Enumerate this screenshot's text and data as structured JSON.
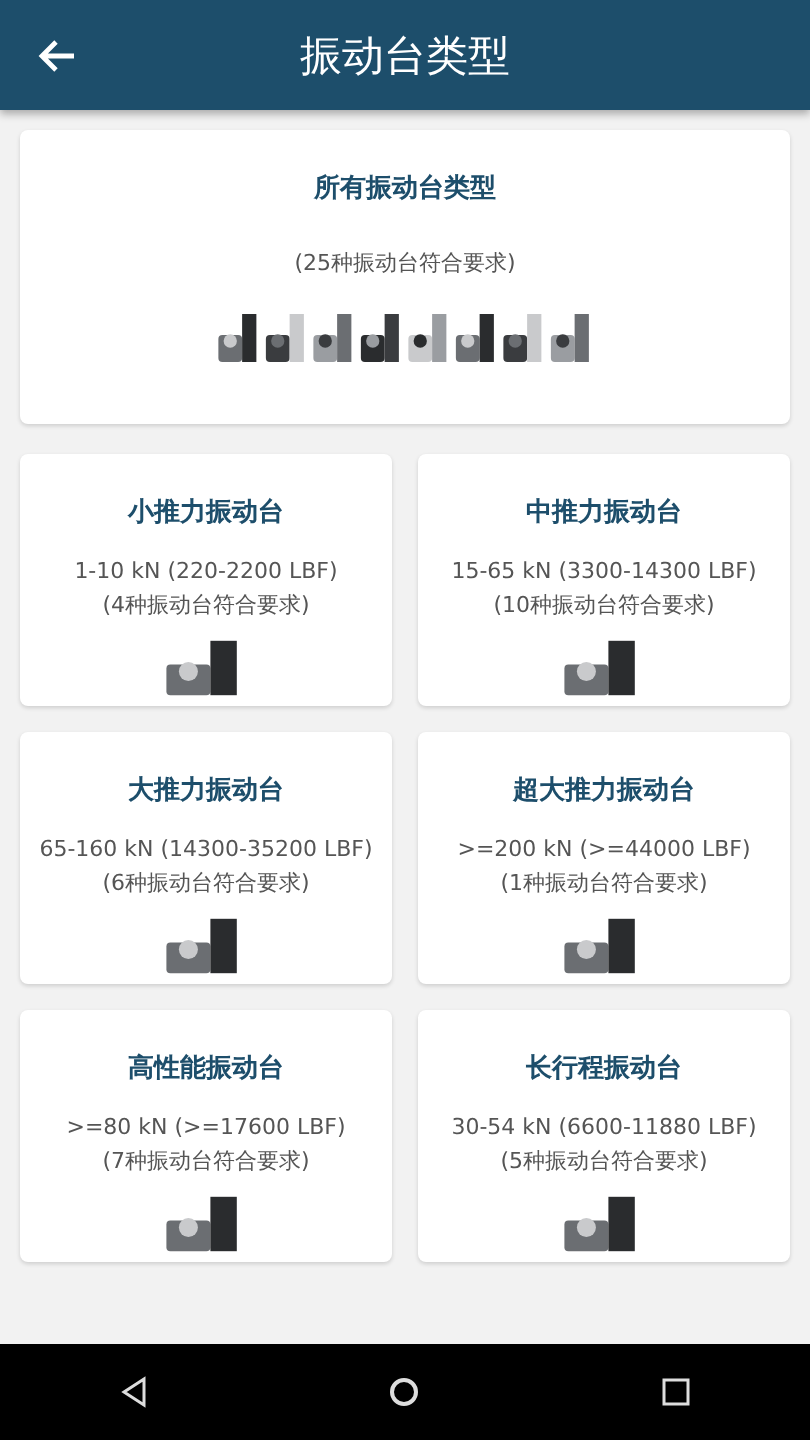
{
  "app_bar": {
    "title": "振动台类型"
  },
  "all_types": {
    "title": "所有振动台类型",
    "count": "(25种振动台符合要求)",
    "kind": "picture"
  },
  "categories": [
    {
      "title": "小推力振动台",
      "range": "1-10 kN (220-2200 LBF)",
      "count": "(4种振动台符合要求)",
      "kind": "picture"
    },
    {
      "title": "中推力振动台",
      "range": "15-65 kN (3300-14300 LBF)",
      "count": "(10种振动台符合要求)",
      "kind": "picture"
    },
    {
      "title": "大推力振动台",
      "range": "65-160 kN (14300-35200 LBF)",
      "count": "(6种振动台符合要求)",
      "kind": "picture"
    },
    {
      "title": "超大推力振动台",
      "range": ">=200 kN (>=44000 LBF)",
      "count": "(1种振动台符合要求)",
      "kind": "picture"
    },
    {
      "title": "高性能振动台",
      "range": ">=80 kN (>=17600 LBF)",
      "count": "(7种振动台符合要求)",
      "kind": "picture"
    },
    {
      "title": "长行程振动台",
      "range": "30-54 kN (6600-11880 LBF)",
      "count": "(5种振动台符合要求)",
      "kind": "picture"
    }
  ]
}
